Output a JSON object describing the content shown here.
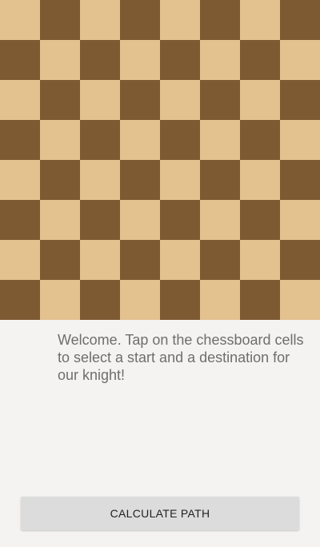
{
  "board": {
    "size": 8,
    "light_color": "#e3c290",
    "dark_color": "#7e5a33",
    "top_left": "light"
  },
  "welcome": {
    "text": "Welcome. Tap on the chessboard cells to select a start and a destination for our knight!"
  },
  "calculate_button": {
    "label": "CALCULATE PATH",
    "background": "#dcdcdc"
  }
}
